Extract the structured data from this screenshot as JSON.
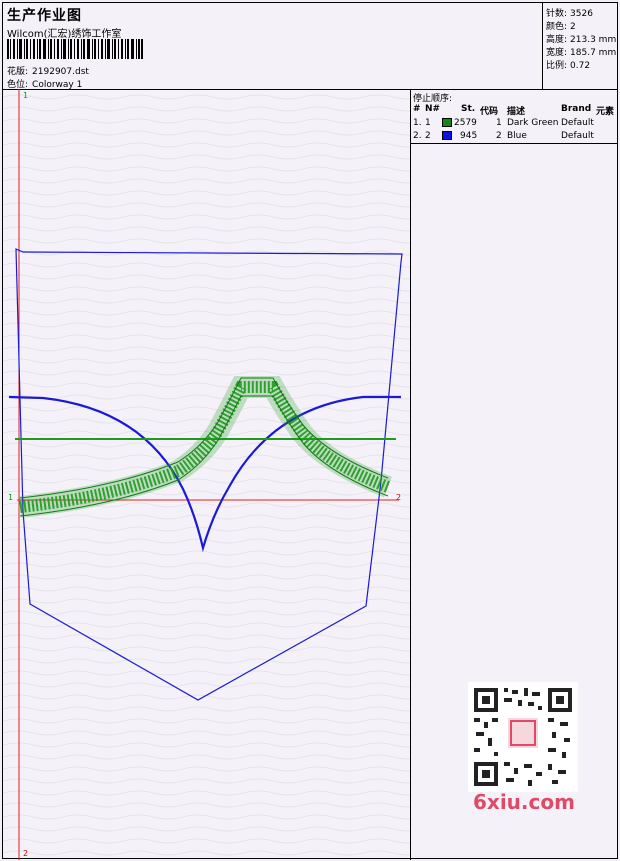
{
  "header": {
    "title": "生产作业图",
    "company": "Wilcom(汇宏)绣饰工作室",
    "design_label": "花版:",
    "design_value": "2192907.dst",
    "colorway_label": "色位:",
    "colorway_value": "Colorway 1"
  },
  "specs": [
    {
      "label": "针数:",
      "value": "3526"
    },
    {
      "label": "颜色:",
      "value": "2"
    },
    {
      "label": "高度:",
      "value": "213.3 mm"
    },
    {
      "label": "宽度:",
      "value": "185.7 mm"
    },
    {
      "label": "比例:",
      "value": "0.72"
    }
  ],
  "stop_sequence": {
    "title": "停止顺序:",
    "columns": [
      "#",
      "N#",
      "St.",
      "代码",
      "描述",
      "Brand",
      "元素"
    ],
    "rows": [
      {
        "idx": "1.",
        "n": "1",
        "color": "#128a12",
        "stitches": "2579",
        "code": "1",
        "desc": "Dark Green",
        "brand": "Default"
      },
      {
        "idx": "2.",
        "n": "2",
        "color": "#1010e0",
        "stitches": "945",
        "code": "2",
        "desc": "Blue",
        "brand": "Default"
      }
    ]
  },
  "axes": {
    "v_top": "1",
    "v_bottom": "2",
    "h_left": "1",
    "h_right": "2"
  },
  "colors": {
    "pocket_outline": "#1a1ad8",
    "green_thread": "#1e9a1e",
    "axis_red": "#e02020"
  },
  "watermark": "6xiu.com"
}
